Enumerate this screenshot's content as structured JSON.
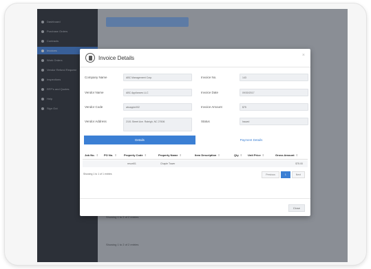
{
  "sidebar": {
    "items": [
      {
        "label": "Dashboard",
        "active": false
      },
      {
        "label": "Purchase Orders",
        "active": false
      },
      {
        "label": "Contracts",
        "active": false
      },
      {
        "label": "Invoices",
        "active": true
      },
      {
        "label": "Work Orders",
        "active": false
      },
      {
        "label": "Vendor Refund Request",
        "active": false
      },
      {
        "label": "Inspections",
        "active": false
      },
      {
        "label": "RFP's and Quotes",
        "active": false
      },
      {
        "label": "Help",
        "active": false
      },
      {
        "label": "Sign Out",
        "active": false
      }
    ]
  },
  "background": {
    "showing_a": "Showing 1 to 2 of 2 entries",
    "showing_b": "Showing 1 to 2 of 2 entries"
  },
  "modal": {
    "title": "Invoice Details",
    "close_x": "×",
    "left_fields": [
      {
        "label": "Company Name",
        "value": "ABC Management Corp."
      },
      {
        "label": "Vendor Name",
        "value": "ABC Appliances LLC"
      },
      {
        "label": "Vendor Code",
        "value": "abcapplc002"
      },
      {
        "label": "Vendor Address",
        "value": "2101 Street Ave. Raleigh, NC 27606"
      }
    ],
    "right_fields": [
      {
        "label": "Invoice No.",
        "value": "143"
      },
      {
        "label": "Invoice Date",
        "value": "09/30/2017"
      },
      {
        "label": "Invoice Amount",
        "value": "$75"
      },
      {
        "label": "Status",
        "value": "Issued"
      }
    ],
    "tabs": [
      {
        "label": "Details",
        "active": true
      },
      {
        "label": "Payment Details",
        "active": false
      }
    ],
    "table": {
      "columns": [
        "Job No.",
        "PO No.",
        "Property Code",
        "Property Name",
        "Item Description",
        "Qty",
        "Unit Price",
        "Gross Amount"
      ],
      "sort_glyph": "⇕",
      "rows": [
        [
          "",
          "",
          "resort01",
          "Chaple Tower",
          "",
          "",
          "",
          "$75.00"
        ]
      ]
    },
    "showing": "Showing 1 to 1 of 1 entries",
    "pager": {
      "previous": "Previous",
      "current": "1",
      "next": "Next"
    },
    "close_button": "Close"
  }
}
